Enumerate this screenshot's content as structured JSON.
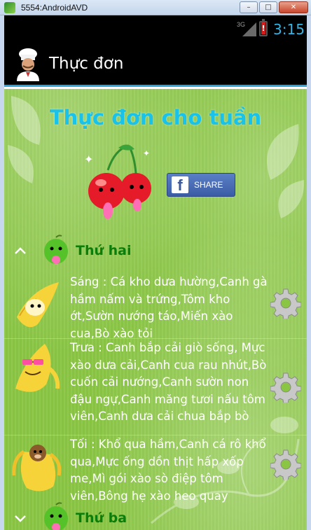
{
  "window": {
    "title": "5554:AndroidAVD",
    "buttons": {
      "minimize": "–",
      "maximize": "□",
      "close": "✕"
    }
  },
  "statusbar": {
    "network": "3G",
    "time": "3:15",
    "colors": {
      "clock": "#33b5e5",
      "battery": "#d41a1a"
    }
  },
  "actionbar": {
    "title": "Thực đơn",
    "icon": "chef-icon",
    "accent": "#2aa3dc"
  },
  "content": {
    "heading": "Thực đơn cho tuần",
    "heading_color": "#18c2e8",
    "share": {
      "label": "SHARE",
      "icon": "facebook-icon"
    },
    "days": [
      {
        "label": "Thứ hai",
        "expanded": true,
        "meals": [
          {
            "text": "Sáng : Cá kho dưa hường,Canh gà hầm nấm và trứng,Tôm kho ớt,Sườn nướng táo,Miến xào cua,Bò xào tỏi",
            "image": "banana-icon"
          },
          {
            "text": "Trưa : Canh bắp cải giò sống, Mực xào dưa cải,Canh cua rau nhút,Bò cuốn cải nướng,Canh sườn non đậu ngự,Canh măng tươi nấu tôm viên,Canh dưa cải chua bắp bò",
            "image": "banana-sunglasses-icon"
          },
          {
            "text": "Tối : Khổ qua hầm,Canh cá rô khổ qua,Mực ống dồn thịt hấp xốp me,Mì gói xào sò điệp tôm viên,Bông hẹ xào heo quay",
            "image": "banana-monkey-icon"
          }
        ]
      },
      {
        "label": "Thứ ba",
        "expanded": false,
        "meals": []
      }
    ],
    "day_label_color": "#0a7d0a",
    "background": "#8ac644"
  }
}
